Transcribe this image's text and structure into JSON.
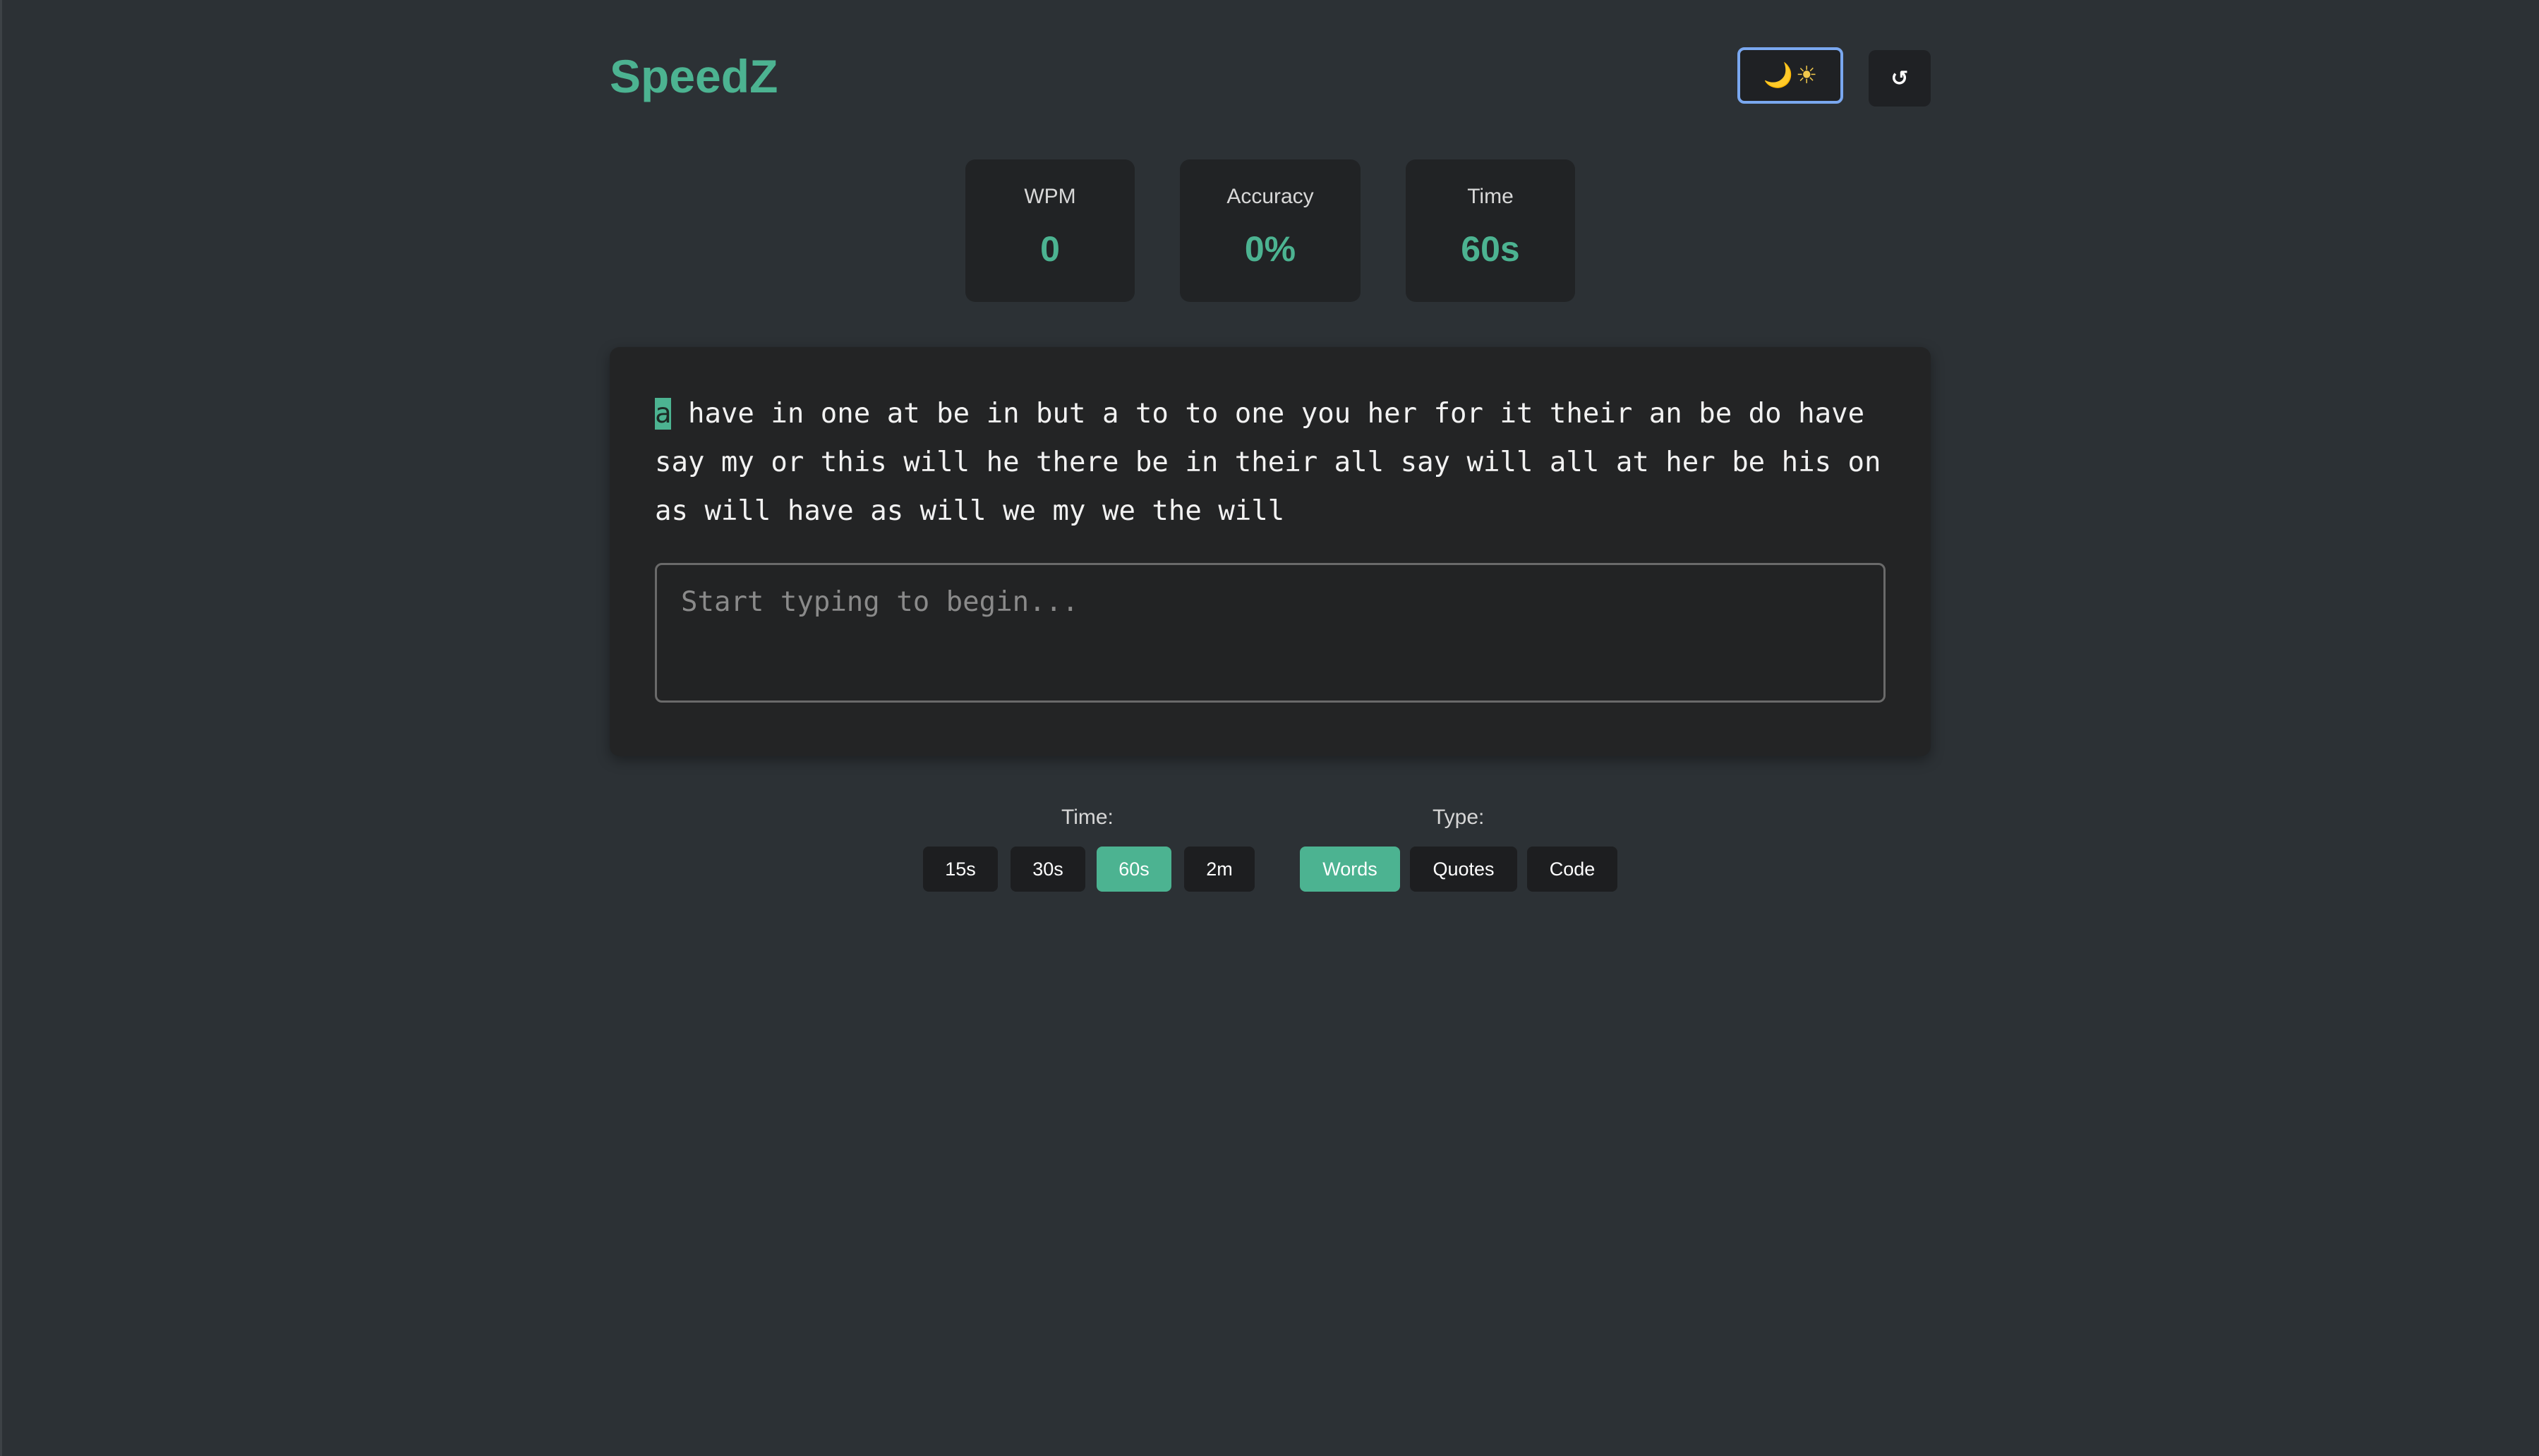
{
  "app": {
    "title": "SpeedZ"
  },
  "header": {
    "theme_toggle": {
      "icons": [
        "moon-icon",
        "sun-icon"
      ],
      "moon_glyph": "🌙",
      "sun_glyph": "☀"
    },
    "reset": {
      "icon": "restart-icon",
      "glyph": "↺"
    }
  },
  "stats": {
    "wpm": {
      "label": "WPM",
      "value": "0"
    },
    "accuracy": {
      "label": "Accuracy",
      "value": "0%"
    },
    "time": {
      "label": "Time",
      "value": "60s"
    }
  },
  "typing": {
    "current_char": "a",
    "remaining_text": " have in one at be in but a to to one you her for it their an be do have say my or this will he there be in their all say will all at her be his on as will have as will we my we the will",
    "input": {
      "value": "",
      "placeholder": "Start typing to begin..."
    }
  },
  "options": {
    "time_label": "Time:",
    "time_options": [
      "15s",
      "30s",
      "60s",
      "2m"
    ],
    "time_selected": "60s",
    "type_label": "Type:",
    "type_options": [
      "Words",
      "Quotes",
      "Code"
    ],
    "type_selected": "Words"
  },
  "colors": {
    "accent": "#4cb391",
    "background": "#2c3135",
    "panel": "#232425",
    "focus_ring": "#7aa8f0"
  }
}
